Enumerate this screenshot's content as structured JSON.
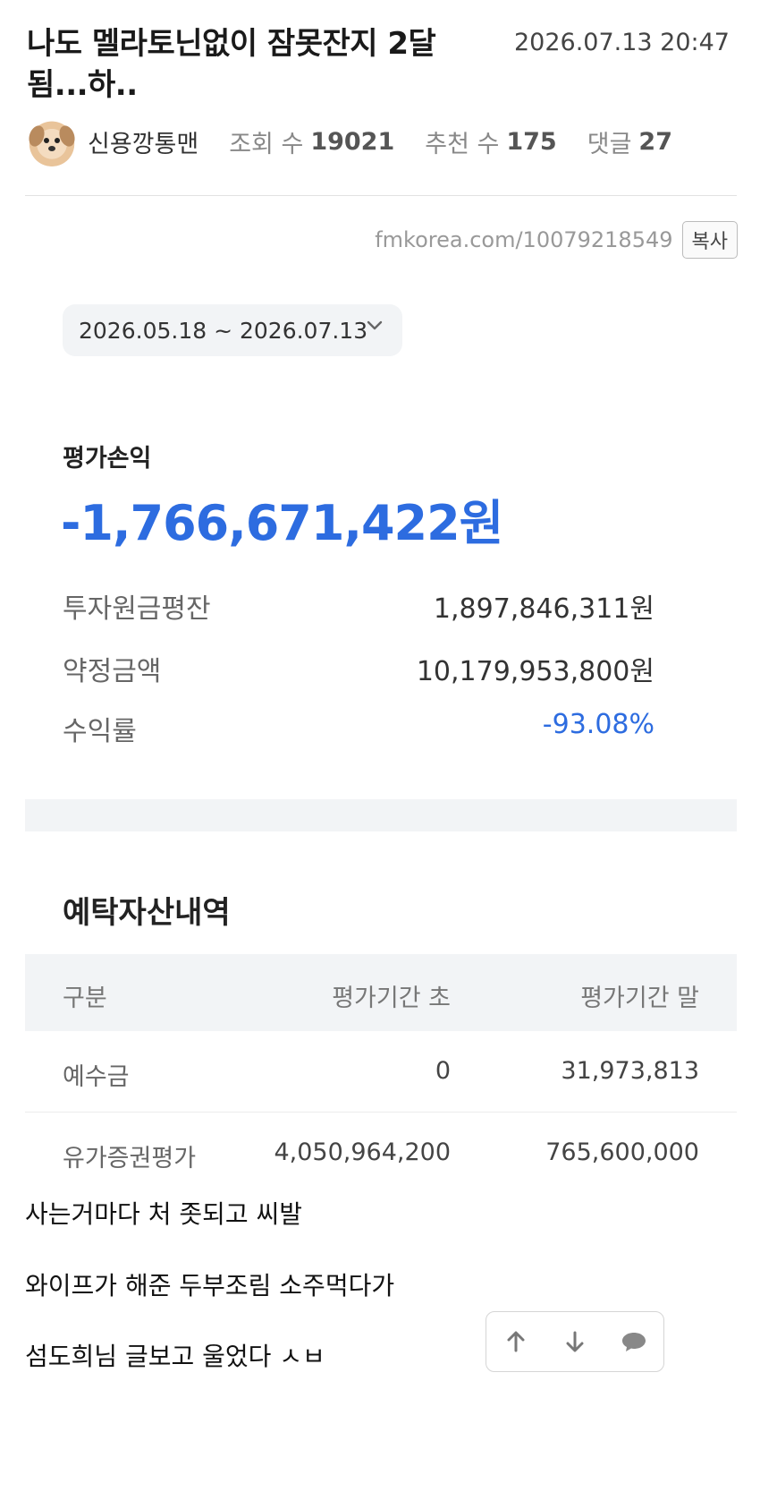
{
  "post": {
    "title": "나도 멜라토닌없이 잠못잔지 2달 됨...하..",
    "date": "2026.07.13 20:47",
    "author": "신용깡통맨",
    "views_label": "조회 수",
    "views": "19021",
    "recommend_label": "추천 수",
    "recommend": "175",
    "comments_label": "댓글",
    "comments": "27",
    "url": "fmkorea.com/10079218549",
    "copy_label": "복사"
  },
  "capture": {
    "date_range": "2026.05.18 ~ 2026.07.13",
    "pl_title": "평가손익",
    "pl_amount": "-1,766,671,422원",
    "rows": [
      {
        "label": "투자원금평잔",
        "value": "1,897,846,311원"
      },
      {
        "label": "약정금액",
        "value": "10,179,953,800원"
      },
      {
        "label": "수익률",
        "value": "-93.08%"
      }
    ],
    "section_title": "예탁자산내역",
    "table": {
      "headers": [
        "구분",
        "평가기간 초",
        "평가기간 말"
      ],
      "rows": [
        [
          "예수금",
          "0",
          "31,973,813"
        ],
        [
          "유가증권평가",
          "4,050,964,200",
          "765,600,000"
        ]
      ]
    }
  },
  "body": {
    "lines": [
      "사는거마다 처 좃되고 씨발",
      "와이프가 해준 두부조림 소주먹다가",
      "섬도희님 글보고 울었다 ㅅㅂ"
    ]
  },
  "nav": {
    "icons": [
      "arrow-up-icon",
      "arrow-down-icon",
      "comment-icon"
    ]
  },
  "colors": {
    "accent_blue": "#2d6ce0",
    "panel_gray": "#f2f4f6"
  }
}
